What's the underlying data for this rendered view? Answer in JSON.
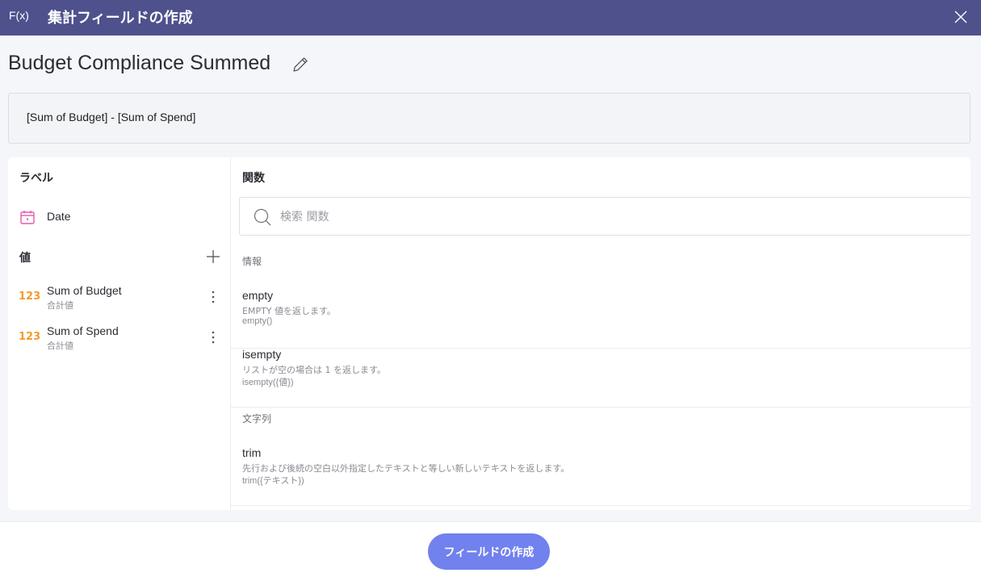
{
  "window": {
    "fx_label": "F(x)",
    "title": "集計フィールドの作成",
    "close_icon": "close-icon"
  },
  "field": {
    "name": "Budget Compliance Summed",
    "edit_icon": "pencil-icon",
    "formula": "[Sum of Budget] - [Sum of Spend]"
  },
  "left_panel": {
    "label_heading": "ラベル",
    "labels": [
      {
        "icon": "calendar-icon",
        "name": "Date"
      }
    ],
    "value_heading": "値",
    "add_icon": "plus-icon",
    "values": [
      {
        "type_badge": "123",
        "name": "Sum of Budget",
        "aggregation": "合計値"
      },
      {
        "type_badge": "123",
        "name": "Sum of Spend",
        "aggregation": "合計値"
      }
    ]
  },
  "right_panel": {
    "heading": "関数",
    "search": {
      "placeholder": "検索 関数",
      "value": ""
    },
    "categories": [
      {
        "name": "情報",
        "functions": [
          {
            "name": "empty",
            "description": "EMPTY 値を返します。",
            "signature": "empty()"
          },
          {
            "name": "isempty",
            "description": "リストが空の場合は 1 を返します。",
            "signature": "isempty({値})"
          }
        ]
      },
      {
        "name": "文字列",
        "functions": [
          {
            "name": "trim",
            "description": "先行および後続の空白以外指定したテキストと等しい新しいテキストを返します。",
            "signature": "trim({テキスト})"
          }
        ]
      }
    ]
  },
  "footer": {
    "create_label": "フィールドの作成"
  },
  "colors": {
    "title_bar": "#4e518c",
    "accent_button": "#7181ee",
    "numeric_badge": "#f29c2b",
    "date_icon": "#e85aa8"
  }
}
